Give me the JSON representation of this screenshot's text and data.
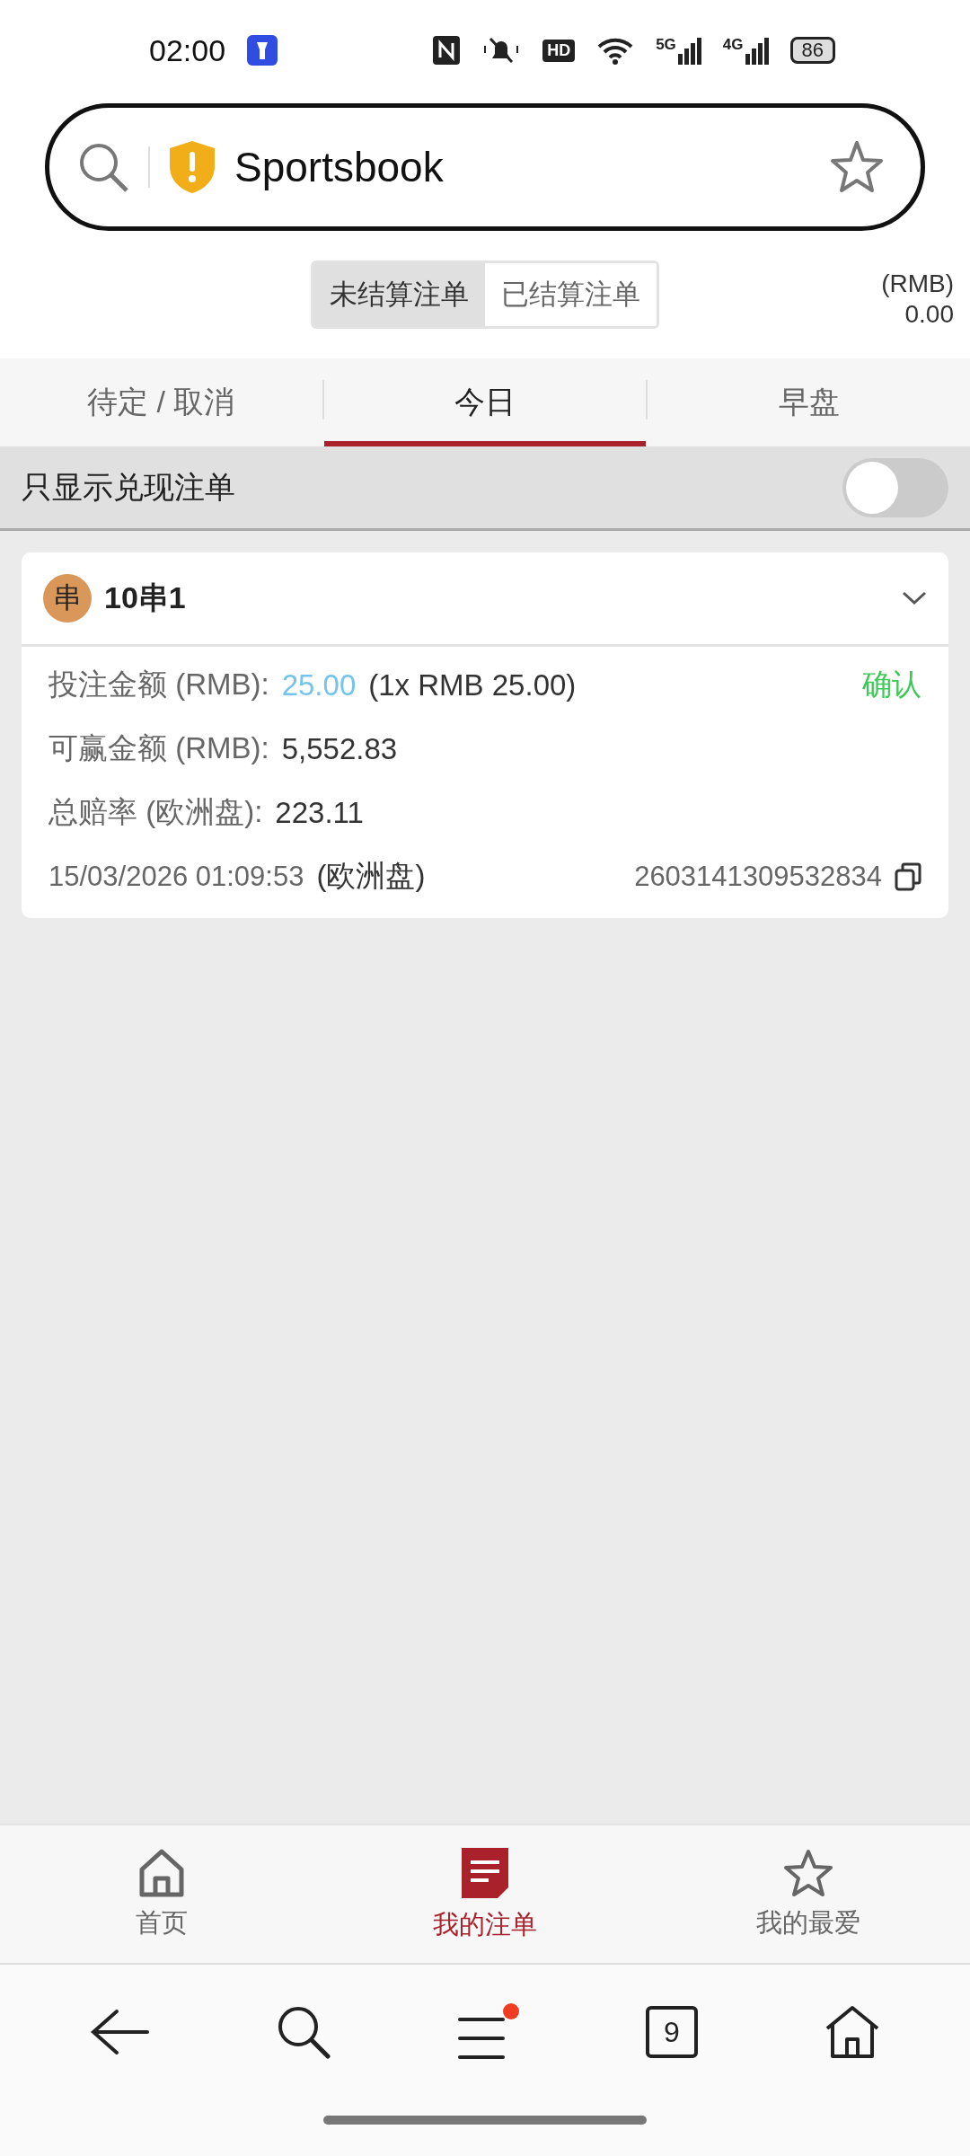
{
  "status_bar": {
    "time": "02:00",
    "hd_label": "HD",
    "network_labels": [
      "5G",
      "4G"
    ],
    "battery": "86"
  },
  "address_bar": {
    "title": "Sportsbook"
  },
  "bet_filter": {
    "segments": [
      {
        "label": "未结算注单",
        "selected": true
      },
      {
        "label": "已结算注单",
        "selected": false
      }
    ],
    "currency": "(RMB)",
    "balance": "0.00"
  },
  "tabs": [
    {
      "label": "待定 / 取消",
      "selected": false
    },
    {
      "label": "今日",
      "selected": true
    },
    {
      "label": "早盘",
      "selected": false
    }
  ],
  "cashout_filter": {
    "label": "只显示兑现注单",
    "on": false
  },
  "bets": [
    {
      "badge": "串",
      "title": "10串1",
      "stake_label": "投注金额 (RMB):",
      "stake": "25.00",
      "stake_detail": "(1x RMB 25.00)",
      "status": "确认",
      "win_label": "可赢金额 (RMB):",
      "win": "5,552.83",
      "odds_label": "总赔率 (欧洲盘):",
      "odds": "223.11",
      "time": "15/03/2026 01:09:53",
      "odds_type": "(欧洲盘)",
      "ticket": "2603141309532834"
    }
  ],
  "bottom_nav": [
    {
      "label": "首页",
      "kind": "home",
      "selected": false
    },
    {
      "label": "我的注单",
      "kind": "bets",
      "selected": true
    },
    {
      "label": "我的最爱",
      "kind": "favorites",
      "selected": false
    }
  ],
  "browser_bar": {
    "tab_count": "9",
    "menu_notification": true
  }
}
